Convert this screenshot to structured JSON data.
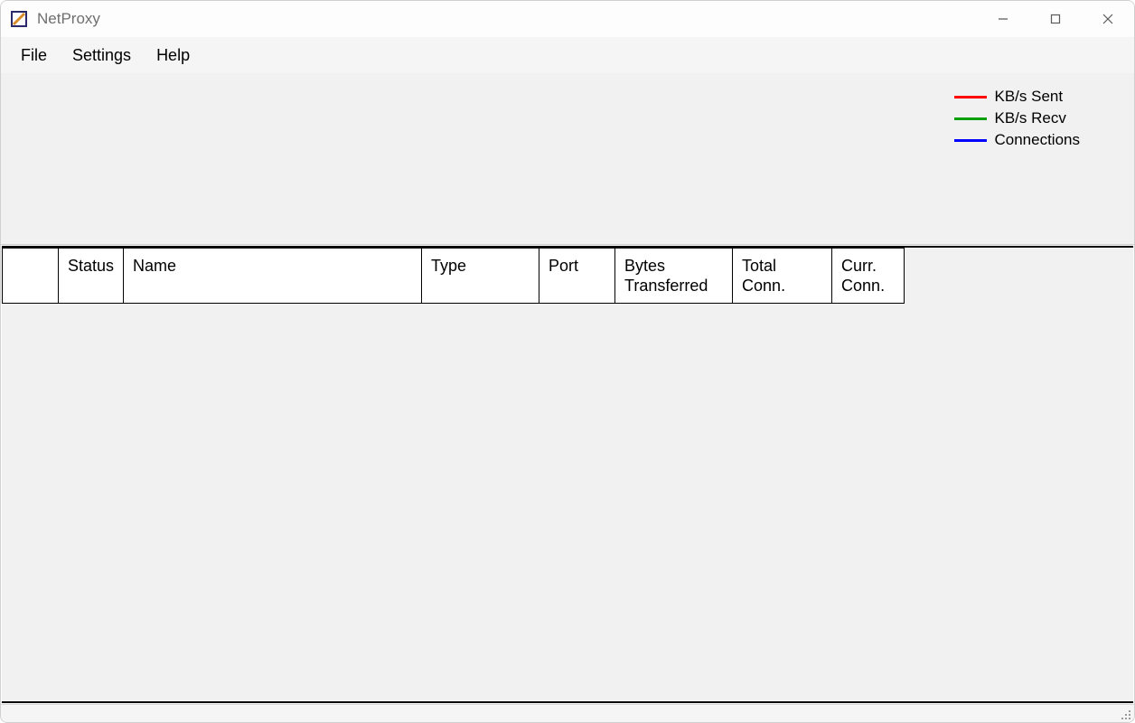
{
  "window": {
    "title": "NetProxy"
  },
  "menu": {
    "file": "File",
    "settings": "Settings",
    "help": "Help"
  },
  "legend": {
    "sent": {
      "label": "KB/s Sent",
      "color": "#ff0000"
    },
    "recv": {
      "label": "KB/s Recv",
      "color": "#00a000"
    },
    "conn": {
      "label": "Connections",
      "color": "#0000ff"
    }
  },
  "table": {
    "columns": {
      "c0": "",
      "status": "Status",
      "name": "Name",
      "type": "Type",
      "port": "Port",
      "bytes": "Bytes Transferred",
      "total": "Total Conn.",
      "curr": "Curr. Conn."
    },
    "rows": []
  }
}
